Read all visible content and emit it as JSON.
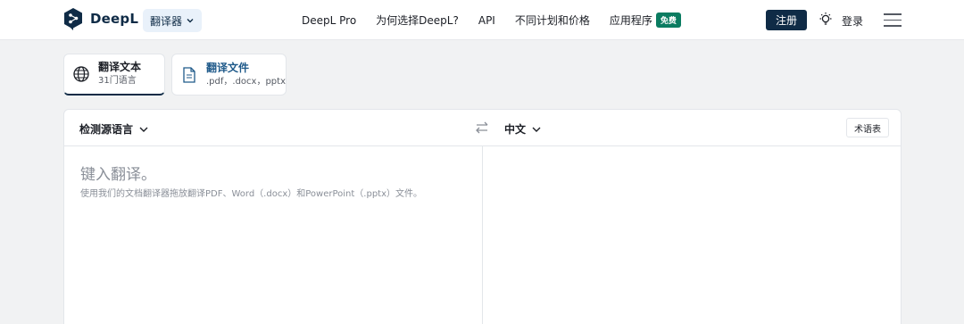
{
  "header": {
    "brand": "DeepL",
    "translator_menu": "翻译器",
    "nav": [
      {
        "label": "DeepL Pro"
      },
      {
        "label": "为何选择DeepL?"
      },
      {
        "label": "API"
      },
      {
        "label": "不同计划和价格"
      },
      {
        "label": "应用程序",
        "badge": "免费"
      }
    ],
    "signup": "注册",
    "login": "登录"
  },
  "tabs": {
    "text": {
      "title": "翻译文本",
      "subtitle": "31门语言"
    },
    "file": {
      "title": "翻译文件",
      "subtitle": ".pdf，.docx，pptx"
    }
  },
  "translator": {
    "source_lang": "检测源语言",
    "target_lang": "中文",
    "glossary": "术语表",
    "input_placeholder": "键入翻译。",
    "input_hint": "使用我们的文档翻译器拖放翻译PDF、Word（.docx）和PowerPoint（.pptx）文件。"
  },
  "colors": {
    "brand_navy": "#0f2b46",
    "free_badge": "#0b7c61",
    "page_bg": "#f1f2f3"
  }
}
